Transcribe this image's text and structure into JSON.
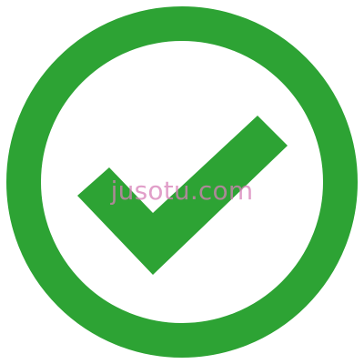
{
  "icon": {
    "name": "check-circle-icon",
    "color": "#2DA334",
    "background": "#ffffff"
  },
  "watermark": {
    "text": "jusotu.com",
    "color": "#D77FB8"
  }
}
